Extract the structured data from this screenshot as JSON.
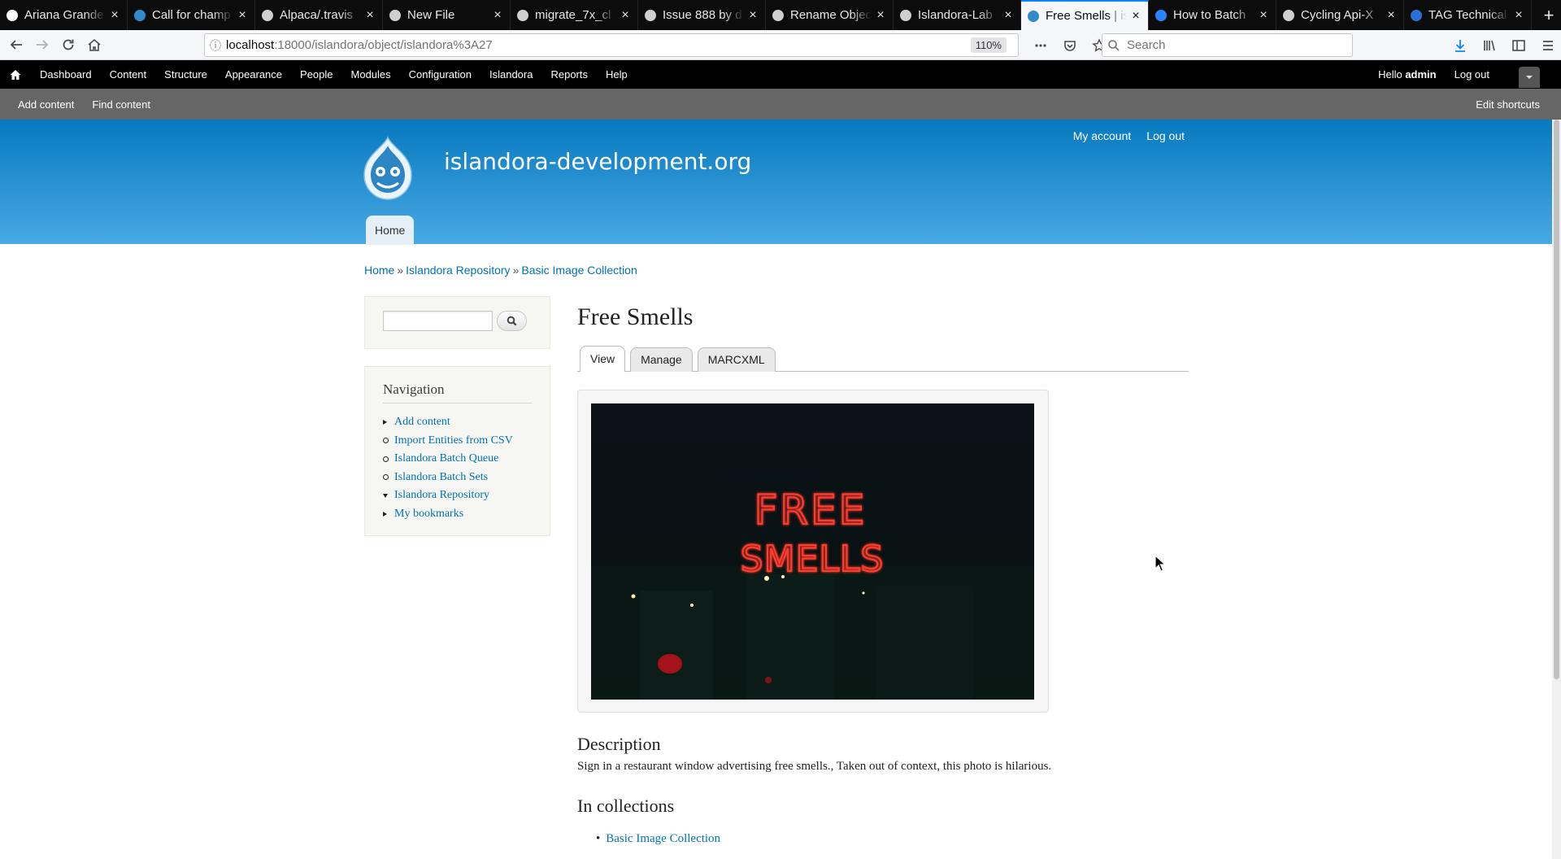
{
  "browser": {
    "tabs": [
      {
        "title": "Ariana Grande",
        "favicon_color": "#ffffff"
      },
      {
        "title": "Call for champ",
        "favicon_color": "#2f8bcc"
      },
      {
        "title": "Alpaca/.travis",
        "favicon_color": "#cfcfcf"
      },
      {
        "title": "New File",
        "favicon_color": "#cfcfcf"
      },
      {
        "title": "migrate_7x_cl",
        "favicon_color": "#cfcfcf"
      },
      {
        "title": "Issue 888 by d",
        "favicon_color": "#cfcfcf"
      },
      {
        "title": "Rename Objec",
        "favicon_color": "#cfcfcf"
      },
      {
        "title": "Islandora-Lab",
        "favicon_color": "#cfcfcf"
      },
      {
        "title": "Free Smells | is",
        "favicon_color": "#2f8bcc",
        "active": true
      },
      {
        "title": "How to Batch",
        "favicon_color": "#2684ff"
      },
      {
        "title": "Cycling Api-X",
        "favicon_color": "#cfcfcf"
      },
      {
        "title": "TAG Technical",
        "favicon_color": "#2a6fd6"
      }
    ],
    "url_host": "localhost",
    "url_path": ":18000/islandora/object/islandora%3A27",
    "zoom": "110%",
    "search_placeholder": "Search"
  },
  "admin_toolbar": {
    "items": [
      "Dashboard",
      "Content",
      "Structure",
      "Appearance",
      "People",
      "Modules",
      "Configuration",
      "Islandora",
      "Reports",
      "Help"
    ],
    "hello": "Hello",
    "user": "admin",
    "logout": "Log out"
  },
  "shortcuts": {
    "items": [
      "Add content",
      "Find content"
    ],
    "edit": "Edit shortcuts"
  },
  "site": {
    "name": "islandora-development.org",
    "secondary_menu": [
      "My account",
      "Log out"
    ],
    "main_menu": [
      "Home"
    ]
  },
  "breadcrumb": {
    "items": [
      "Home",
      "Islandora Repository",
      "Basic Image Collection"
    ],
    "separator": "»"
  },
  "sidebar": {
    "navigation_title": "Navigation",
    "items": [
      {
        "label": "Add content",
        "bullet": "tri-right"
      },
      {
        "label": "Import Entities from CSV",
        "bullet": "circle"
      },
      {
        "label": "Islandora Batch Queue",
        "bullet": "circle"
      },
      {
        "label": "Islandora Batch Sets",
        "bullet": "circle"
      },
      {
        "label": "Islandora Repository",
        "bullet": "tri-down"
      },
      {
        "label": "My bookmarks",
        "bullet": "tri-right"
      }
    ]
  },
  "page": {
    "title": "Free Smells",
    "tabs": [
      "View",
      "Manage",
      "MARCXML"
    ],
    "active_tab": "View",
    "image_text_line1": "FREE",
    "image_text_line2": "SMELLS",
    "description_heading": "Description",
    "description": "Sign in a restaurant window advertising free smells., Taken out of context, this photo is hilarious.",
    "collections_heading": "In collections",
    "collections": [
      "Basic Image Collection"
    ]
  },
  "colors": {
    "link": "#0071b3",
    "header_top": "#0779bf",
    "header_bottom": "#48a9e4",
    "neon": "#ff3b2e"
  }
}
